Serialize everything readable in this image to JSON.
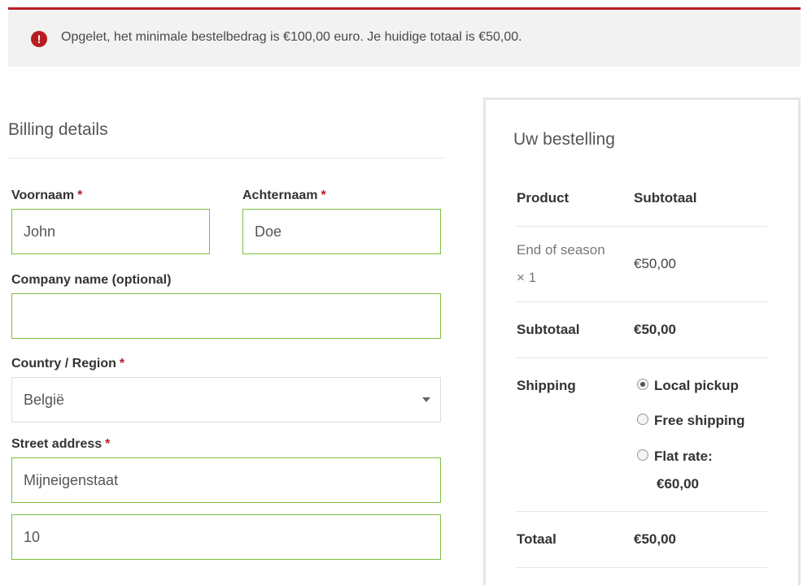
{
  "notice": {
    "icon": "exclamation-icon",
    "text": "Opgelet, het minimale bestelbedrag is €100,00 euro. Je huidige totaal is €50,00.",
    "accent": "#b81c23"
  },
  "billing": {
    "title": "Billing details",
    "required_mark": "*",
    "first_name": {
      "label": "Voornaam",
      "value": "John"
    },
    "last_name": {
      "label": "Achternaam",
      "value": "Doe"
    },
    "company": {
      "label": "Company name (optional)",
      "value": ""
    },
    "country": {
      "label": "Country / Region",
      "value": "België"
    },
    "street": {
      "label": "Street address",
      "line1": "Mijneigenstaat",
      "line2": "10"
    }
  },
  "order": {
    "title": "Uw bestelling",
    "col_product": "Product",
    "col_subtotal": "Subtotaal",
    "item": {
      "name": "End of season",
      "qty": "× 1",
      "price": "€50,00"
    },
    "subtotal": {
      "label": "Subtotaal",
      "value": "€50,00"
    },
    "shipping": {
      "label": "Shipping",
      "options": [
        {
          "label": "Local pickup",
          "checked": true
        },
        {
          "label": "Free shipping",
          "checked": false
        },
        {
          "label": "Flat rate:",
          "price": "€60,00",
          "checked": false
        }
      ]
    },
    "total": {
      "label": "Totaal",
      "value": "€50,00"
    }
  },
  "colors": {
    "field_border": "#7cbf3e",
    "accent": "#b81c23"
  }
}
